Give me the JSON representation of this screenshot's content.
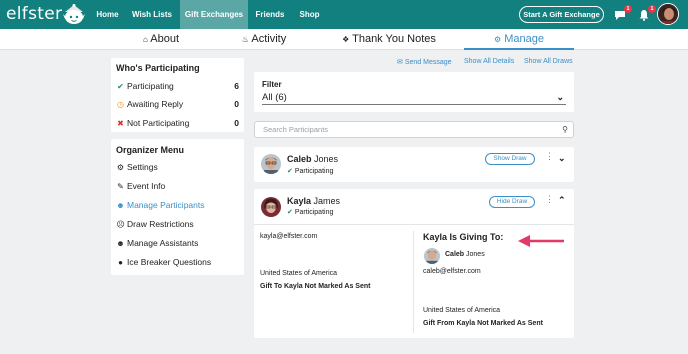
{
  "topnav": {
    "logo": "elfster",
    "links": [
      "Home",
      "Wish Lists",
      "Gift Exchanges",
      "Friends",
      "Shop"
    ],
    "start_button": "Start A Gift Exchange",
    "message_badge": "1",
    "notification_badge": "1"
  },
  "subnav": {
    "tabs": [
      "About",
      "Activity",
      "Thank You Notes",
      "Manage"
    ]
  },
  "participants_panel": {
    "title": "Who's Participating",
    "rows": [
      {
        "label": "Participating",
        "count": "6"
      },
      {
        "label": "Awaiting Reply",
        "count": "0"
      },
      {
        "label": "Not Participating",
        "count": "0"
      }
    ]
  },
  "organizer_menu": {
    "title": "Organizer Menu",
    "items": [
      "Settings",
      "Event Info",
      "Manage Participants",
      "Draw Restrictions",
      "Manage Assistants",
      "Ice Breaker Questions"
    ]
  },
  "action_links": [
    "Send Message",
    "Show All Details",
    "Show All Draws"
  ],
  "filter": {
    "label": "Filter",
    "value": "All (6)"
  },
  "search": {
    "placeholder": "Search Participants"
  },
  "participants": [
    {
      "first": "Caleb",
      "last": "Jones",
      "status": "Participating",
      "button": "Show Draw"
    },
    {
      "first": "Kayla",
      "last": "James",
      "status": "Participating",
      "button": "Hide Draw",
      "email": "kayla@elfster.com",
      "country": "United States of America",
      "gift_status": "Gift To Kayla Not Marked As Sent",
      "giving_to": {
        "heading": "Kayla Is Giving To:",
        "first": "Caleb",
        "last": "Jones",
        "email": "caleb@elfster.com",
        "country": "United States of America",
        "gift_status": "Gift From Kayla Not Marked As Sent"
      }
    }
  ]
}
